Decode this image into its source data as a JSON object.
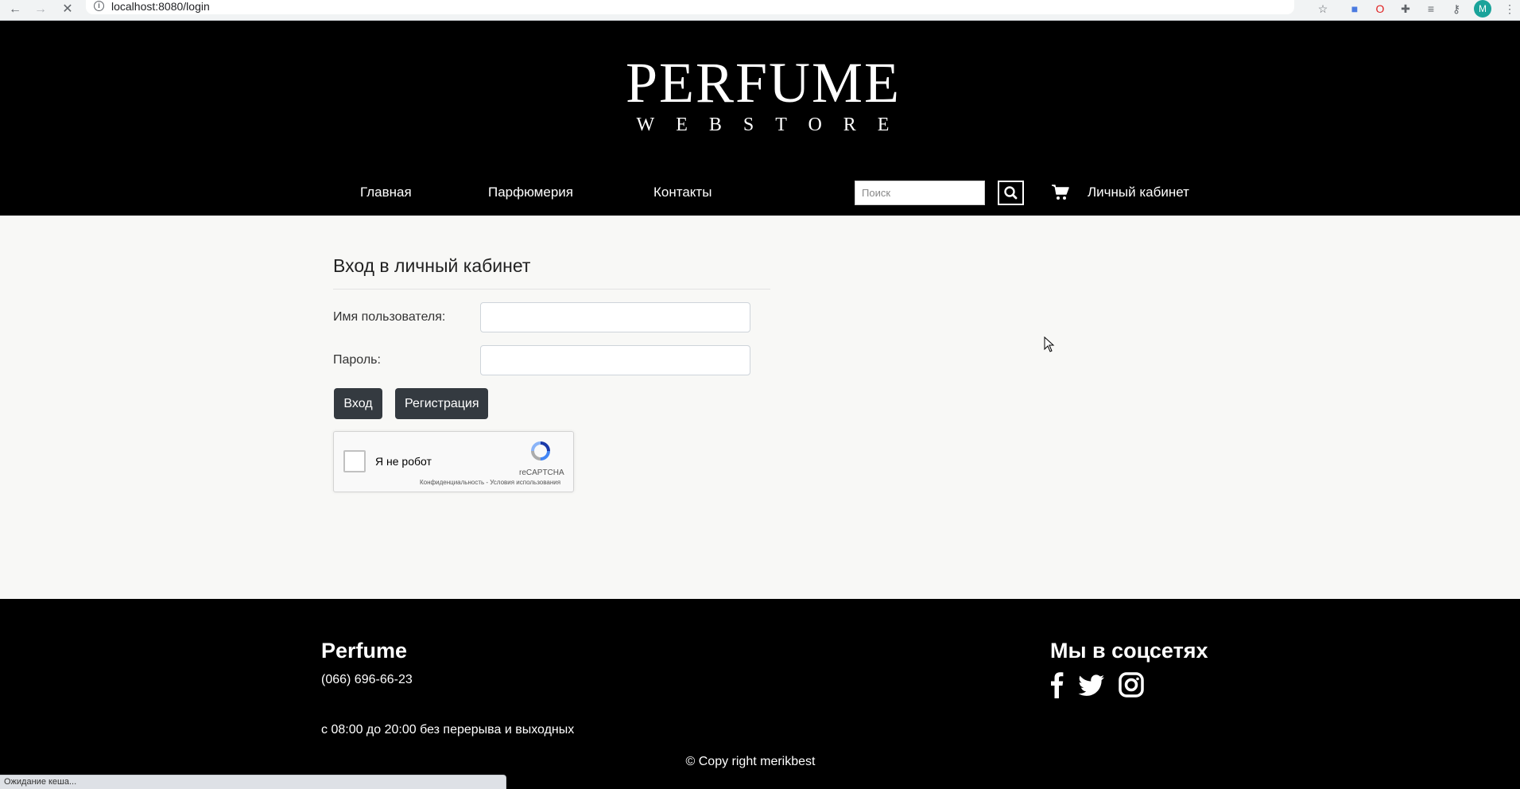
{
  "browser": {
    "url": "localhost:8080/login"
  },
  "header": {
    "logo_main": "PERFUME",
    "logo_sub": "WEBSTORE",
    "nav": {
      "home": "Главная",
      "perfumery": "Парфюмерия",
      "contacts": "Контакты",
      "account": "Личный кабинет"
    },
    "search_placeholder": "Поиск"
  },
  "login": {
    "title": "Вход в личный кабинет",
    "username_label": "Имя пользователя:",
    "password_label": "Пароль:",
    "login_button": "Вход",
    "register_button": "Регистрация"
  },
  "captcha": {
    "label": "Я не робот",
    "brand": "reCAPTCHA",
    "links": "Конфиденциальность - Условия использования"
  },
  "footer": {
    "brand": "Perfume",
    "phone": "(066) 696-66-23",
    "hours": "с 08:00 до 20:00 без перерыва и выходных",
    "social_title": "Мы в соцсетях",
    "copyright": "© Copy right merikbest"
  },
  "status_bar": "Ожидание кеша..."
}
